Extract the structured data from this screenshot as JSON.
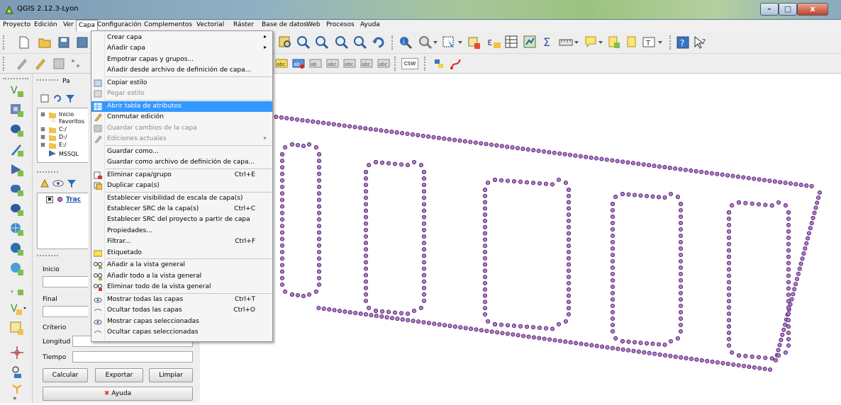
{
  "window": {
    "title": "QGIS 2.12.3-Lyon"
  },
  "menubar": [
    "Proyecto",
    "Edición",
    "Ver",
    "Capa",
    "Configuración",
    "Complementos",
    "Vectorial",
    "Ráster",
    "Base de datos",
    "Web",
    "Procesos",
    "Ayuda"
  ],
  "capa_menu": {
    "items": [
      {
        "label": "Crear capa",
        "submenu": true
      },
      {
        "label": "Añadir capa",
        "submenu": true
      },
      {
        "label": "Empotrar capas y grupos..."
      },
      {
        "label": "Añadir desde archivo de definición de capa..."
      },
      {
        "label": "Copiar estilo",
        "icon": "copy-style-icon"
      },
      {
        "label": "Pegar estilo",
        "icon": "paste-style-icon",
        "disabled": true
      },
      {
        "label": "Abrir tabla de atributos",
        "icon": "attribute-table-icon",
        "highlighted": true
      },
      {
        "label": "Conmutar edición",
        "icon": "pencil-icon"
      },
      {
        "label": "Guardar cambios de la capa",
        "icon": "save-edits-icon",
        "disabled": true
      },
      {
        "label": "Ediciones actuales",
        "icon": "current-edits-icon",
        "disabled": true,
        "submenu": true
      },
      {
        "label": "Guardar como..."
      },
      {
        "label": "Guardar como archivo de definición de capa..."
      },
      {
        "label": "Eliminar capa/grupo",
        "icon": "remove-layer-icon",
        "shortcut": "Ctrl+E"
      },
      {
        "label": "Duplicar capa(s)",
        "icon": "duplicate-layer-icon"
      },
      {
        "label": "Establecer visibilidad de escala de capa(s)"
      },
      {
        "label": "Establecer SRC de la capa(s)",
        "shortcut": "Ctrl+C"
      },
      {
        "label": "Establecer SRC del proyecto a partir de capa"
      },
      {
        "label": "Propiedades..."
      },
      {
        "label": "Filtrar...",
        "shortcut": "Ctrl+F"
      },
      {
        "label": "Etiquetado",
        "icon": "labeling-icon"
      },
      {
        "label": "Añadir a la vista general",
        "icon": "overview-add-icon"
      },
      {
        "label": "Añadir todo a la vista general",
        "icon": "overview-add-all-icon"
      },
      {
        "label": "Eliminar todo de la vista general",
        "icon": "overview-remove-all-icon"
      },
      {
        "label": "Mostrar todas las capas",
        "icon": "eye-show-icon",
        "shortcut": "Ctrl+T"
      },
      {
        "label": "Ocultar todas las capas",
        "icon": "eye-hide-icon",
        "shortcut": "Ctrl+O"
      },
      {
        "label": "Mostrar capas seleccionadas",
        "icon": "eye-show-selected-icon"
      },
      {
        "label": "Ocultar capas seleccionadas",
        "icon": "eye-hide-selected-icon"
      }
    ]
  },
  "browser": {
    "title": "Pa",
    "items": [
      "Inicio",
      "Favoritos",
      "C:/",
      "D:/",
      "E:/",
      "MSSQL"
    ]
  },
  "layers": {
    "item": "Trac"
  },
  "plugin_panel": {
    "start_label": "Inicio",
    "end_label": "Final",
    "criteria_label": "Criterio",
    "length_label": "Longitud",
    "time_label": "Tiempo",
    "calculate": "Calcular",
    "export": "Exportar",
    "clear": "Limpiar",
    "help": "Ayuda"
  },
  "toolbar2": {
    "csv_label": "CSW"
  },
  "colors": {
    "point_fill": "#b57fd0",
    "point_stroke": "#4a1a63",
    "menu_highlight": "#3399ff"
  }
}
